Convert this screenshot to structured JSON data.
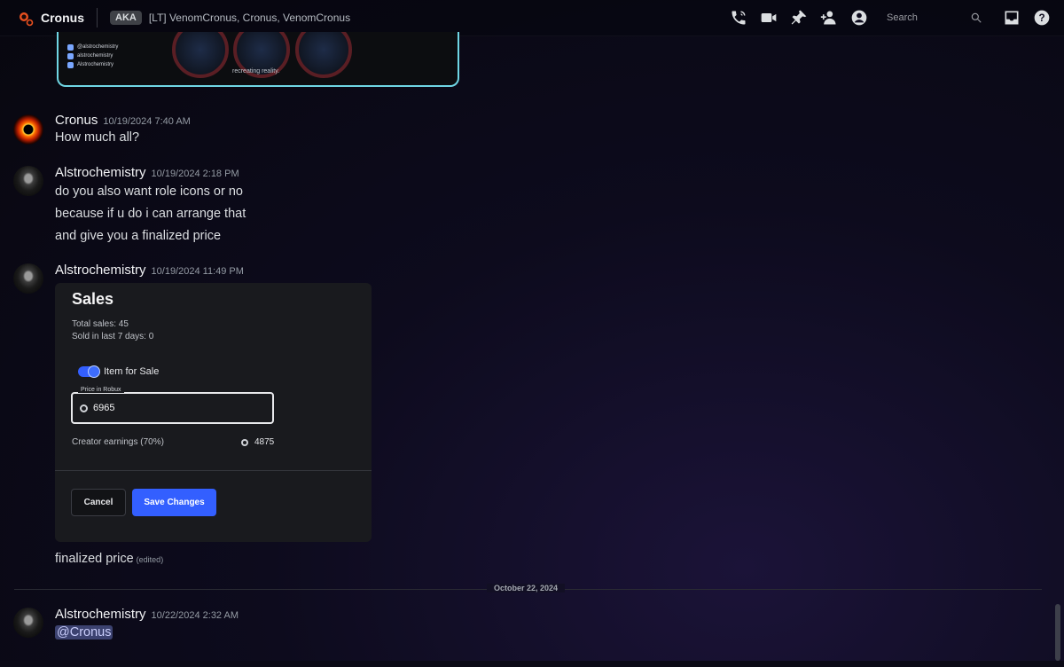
{
  "header": {
    "channel_name": "Cronus",
    "aka_badge": "AKA",
    "aka_names": "[LT] VenomCronus, Cronus, VenomCronus",
    "search_placeholder": "Search",
    "icons": [
      "phone-call-icon",
      "video-call-icon",
      "pin-icon",
      "add-friend-icon",
      "profile-icon",
      "search-icon",
      "inbox-icon",
      "help-icon"
    ]
  },
  "embed_image": {
    "socials": [
      "@alstrochemistry",
      "alstrochemistry",
      "Alstrochemistry"
    ],
    "caption": "recreating reality.",
    "border_color": "#6fd6e4"
  },
  "messages": [
    {
      "author": "Cronus",
      "timestamp": "10/19/2024 7:40 AM",
      "lines": [
        "How much all?"
      ]
    },
    {
      "author": "Alstrochemistry",
      "timestamp": "10/19/2024 2:18 PM",
      "lines": [
        "do you also want role icons or no",
        "because if u do i can arrange that",
        "and give you a finalized price"
      ]
    },
    {
      "author": "Alstrochemistry",
      "timestamp": "10/19/2024 11:49 PM",
      "sales_card": {
        "title": "Sales",
        "total_sales": "Total sales: 45",
        "sold_last_7": "Sold in last 7 days: 0",
        "toggle_label": "Item for Sale",
        "toggle_on": true,
        "price_label": "Price in Robux",
        "price_value": "6965",
        "earnings_label": "Creator earnings (70%)",
        "earnings_value": "4875",
        "cancel_label": "Cancel",
        "save_label": "Save Changes",
        "accent": "#335fff"
      },
      "lines": [
        "finalized price"
      ],
      "edited": "(edited)"
    },
    {
      "author": "Alstrochemistry",
      "timestamp": "10/22/2024 2:32 AM",
      "mention": "@Cronus"
    }
  ],
  "date_divider": "October 22, 2024"
}
